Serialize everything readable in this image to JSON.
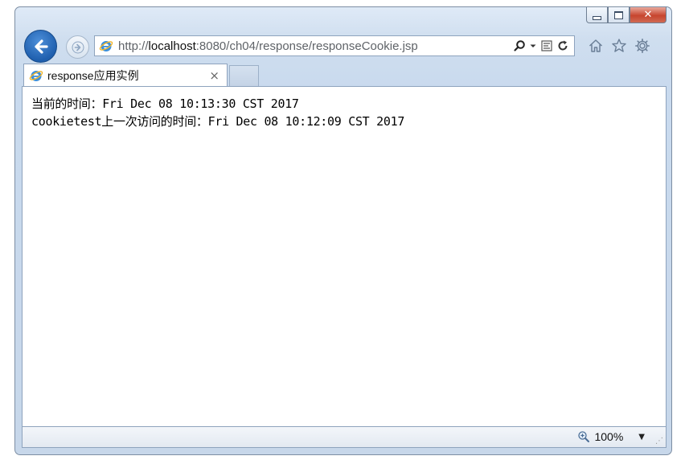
{
  "window": {
    "controls": {
      "minimize": "minimize-icon",
      "maximize": "maximize-icon",
      "close_label": "✕"
    }
  },
  "nav": {
    "back_icon": "arrow-left-icon",
    "forward_icon": "arrow-right-icon"
  },
  "address": {
    "url_prefix": "http://",
    "url_host": "localhost",
    "url_rest": ":8080/ch04/response/responseCookie.jsp",
    "search_icon": "search-icon",
    "dropdown_icon": "dropdown-icon",
    "compat_icon": "compatibility-view-icon",
    "refresh_icon": "refresh-icon"
  },
  "toolbar": {
    "home_icon": "home-icon",
    "favorites_icon": "star-icon",
    "tools_icon": "gear-icon"
  },
  "tab": {
    "title": "response应用实例",
    "close_label": "×"
  },
  "page": {
    "line1": "当前的时间：Fri Dec 08 10:13:30 CST 2017",
    "line2": "cookietest上一次访问的时间：Fri Dec 08 10:12:09 CST 2017"
  },
  "status": {
    "zoom": "100%",
    "zoom_arrow": "▼",
    "resize_grip": "⋰"
  },
  "colors": {
    "frame": "#c9daee",
    "back_button": "#2a6cc0",
    "close_button": "#c7452e"
  }
}
